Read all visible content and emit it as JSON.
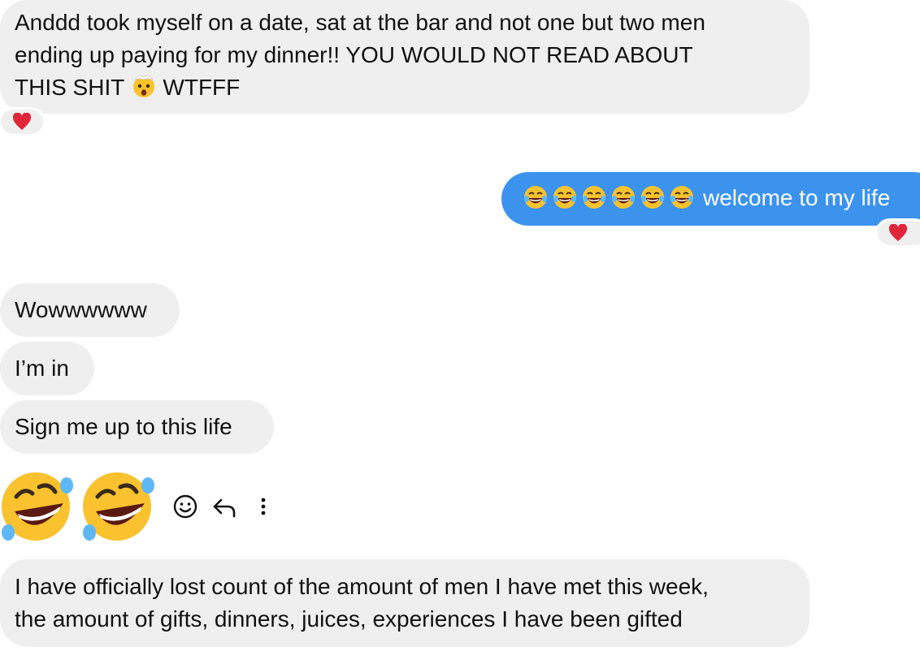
{
  "messages": {
    "m1": {
      "line1": "Anddd took myself on a date, sat at the bar and not one but two men",
      "line2": "ending up paying for my dinner!! YOU WOULD NOT READ ABOUT",
      "line3_before": "THIS SHIT",
      "line3_emoji": "exploding-head-emoji",
      "line3_after": "WTFFF",
      "reaction": "red-heart"
    },
    "m2": {
      "emoji_count": 6,
      "emoji": "tears-of-joy-emoji",
      "text": "welcome to my life",
      "reaction": "red-heart"
    },
    "m3": {
      "text": "Wowwwwww"
    },
    "m4": {
      "text": "I’m in"
    },
    "m5": {
      "text": "Sign me up to this life"
    },
    "m6": {
      "emoji": "rolling-on-floor-laughing-emoji",
      "emoji_count": 2
    },
    "m7": {
      "line1": "I have officially lost count of the amount of men I have met this week,",
      "line2": "the amount of gifts, dinners, juices, experiences I have been gifted"
    }
  },
  "actions": {
    "react": "smiley-icon",
    "reply": "reply-arrow-icon",
    "more": "more-options-icon"
  },
  "colors": {
    "incoming_bubble": "#efefef",
    "outgoing_bubble": "#3b93ee",
    "heart": "#e0263a",
    "emoji_yellow": "#f9c22e"
  }
}
